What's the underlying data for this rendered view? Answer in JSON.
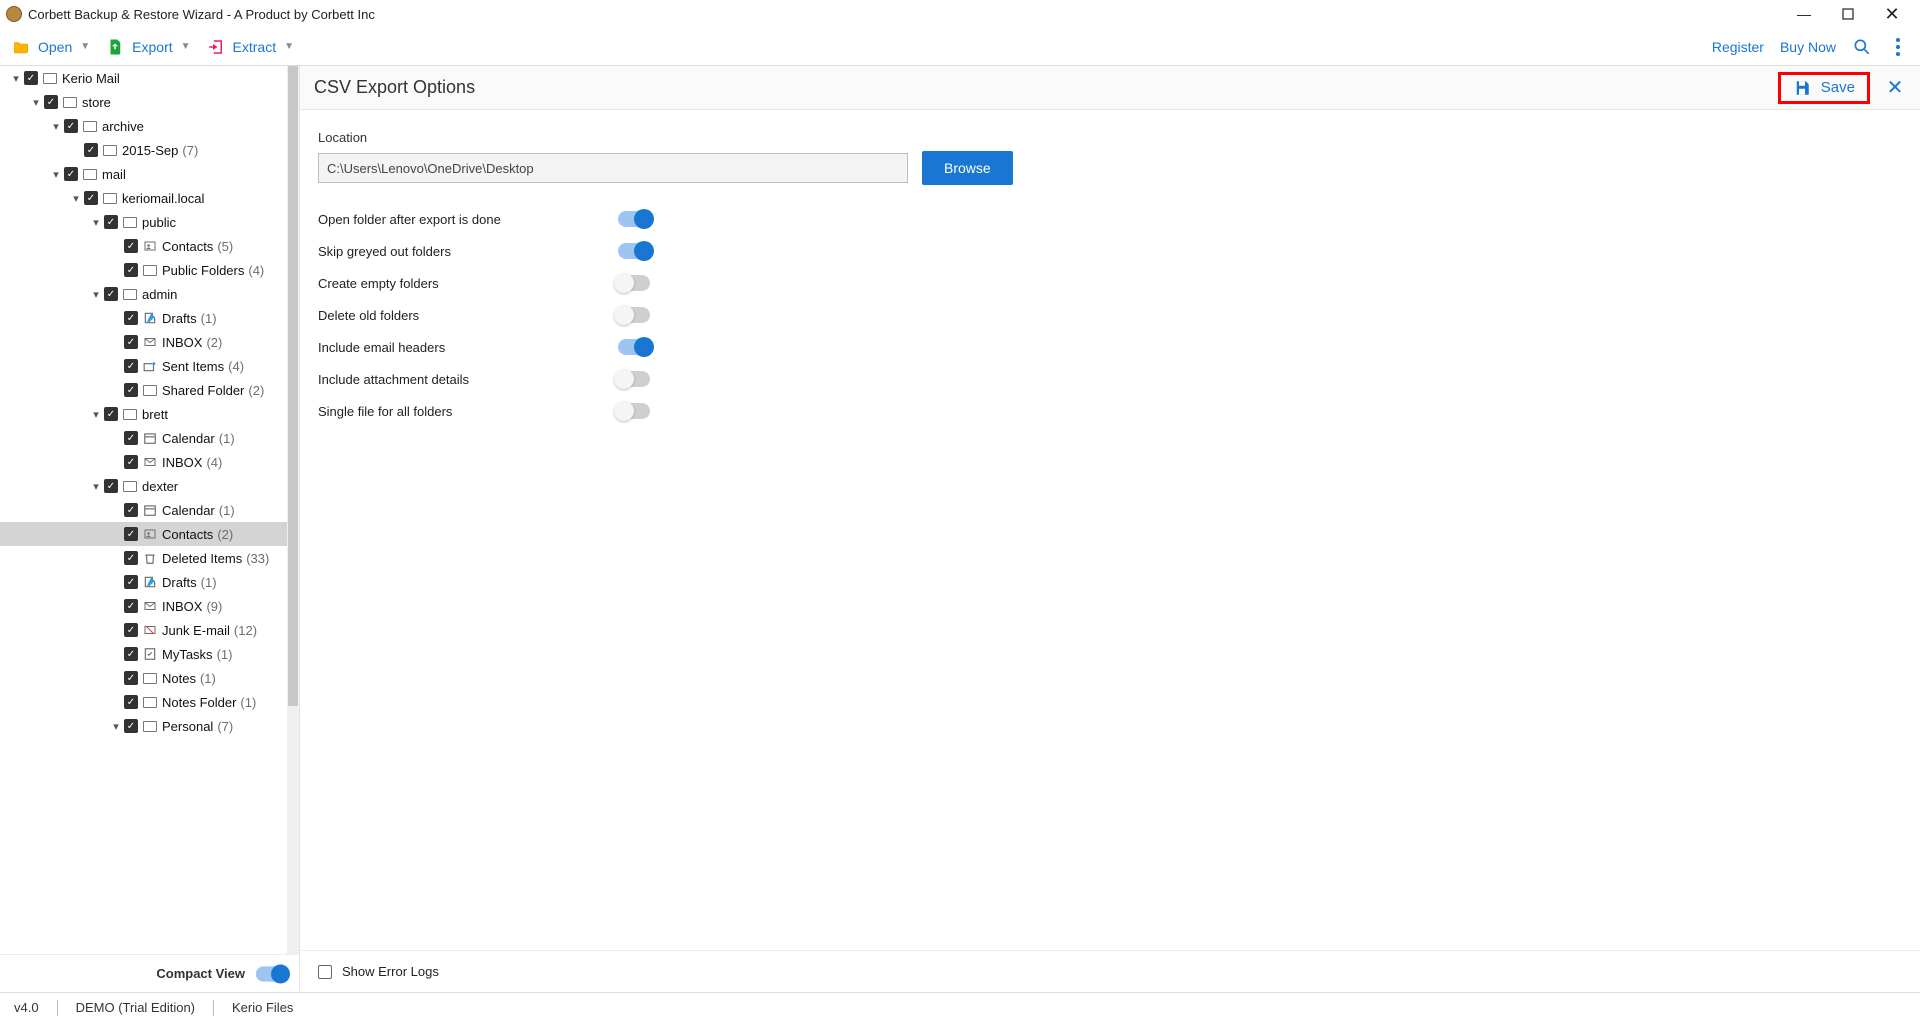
{
  "title": "Corbett Backup & Restore Wizard - A Product by Corbett Inc",
  "toolbar": {
    "open": "Open",
    "export": "Export",
    "extract": "Extract",
    "register": "Register",
    "buy": "Buy Now"
  },
  "tree": [
    {
      "indent": 0,
      "arrow": "down",
      "name": "Kerio Mail",
      "icon": "folder",
      "count": null,
      "selected": false
    },
    {
      "indent": 1,
      "arrow": "down",
      "name": "store",
      "icon": "folder",
      "count": null,
      "selected": false
    },
    {
      "indent": 2,
      "arrow": "down",
      "name": "archive",
      "icon": "folder",
      "count": null,
      "selected": false
    },
    {
      "indent": 3,
      "arrow": "none",
      "name": "2015-Sep",
      "icon": "folder",
      "count": "(7)",
      "selected": false
    },
    {
      "indent": 2,
      "arrow": "down",
      "name": "mail",
      "icon": "folder",
      "count": null,
      "selected": false
    },
    {
      "indent": 3,
      "arrow": "down",
      "name": "keriomail.local",
      "icon": "folder",
      "count": null,
      "selected": false
    },
    {
      "indent": 4,
      "arrow": "down",
      "name": "public",
      "icon": "folder",
      "count": null,
      "selected": false
    },
    {
      "indent": 5,
      "arrow": "none",
      "name": "Contacts",
      "icon": "contacts",
      "count": "(5)",
      "selected": false
    },
    {
      "indent": 5,
      "arrow": "none",
      "name": "Public Folders",
      "icon": "folder",
      "count": "(4)",
      "selected": false
    },
    {
      "indent": 4,
      "arrow": "down",
      "name": "admin",
      "icon": "folder",
      "count": null,
      "selected": false
    },
    {
      "indent": 5,
      "arrow": "none",
      "name": "Drafts",
      "icon": "drafts",
      "count": "(1)",
      "selected": false
    },
    {
      "indent": 5,
      "arrow": "none",
      "name": "INBOX",
      "icon": "inbox",
      "count": "(2)",
      "selected": false
    },
    {
      "indent": 5,
      "arrow": "none",
      "name": "Sent Items",
      "icon": "sent",
      "count": "(4)",
      "selected": false
    },
    {
      "indent": 5,
      "arrow": "none",
      "name": "Shared Folder",
      "icon": "folder",
      "count": "(2)",
      "selected": false
    },
    {
      "indent": 4,
      "arrow": "down",
      "name": "brett",
      "icon": "folder",
      "count": null,
      "selected": false
    },
    {
      "indent": 5,
      "arrow": "none",
      "name": "Calendar",
      "icon": "calendar",
      "count": "(1)",
      "selected": false
    },
    {
      "indent": 5,
      "arrow": "none",
      "name": "INBOX",
      "icon": "inbox",
      "count": "(4)",
      "selected": false
    },
    {
      "indent": 4,
      "arrow": "down",
      "name": "dexter",
      "icon": "folder",
      "count": null,
      "selected": false
    },
    {
      "indent": 5,
      "arrow": "none",
      "name": "Calendar",
      "icon": "calendar",
      "count": "(1)",
      "selected": false
    },
    {
      "indent": 5,
      "arrow": "none",
      "name": "Contacts",
      "icon": "contacts",
      "count": "(2)",
      "selected": true
    },
    {
      "indent": 5,
      "arrow": "none",
      "name": "Deleted Items",
      "icon": "trash",
      "count": "(33)",
      "selected": false
    },
    {
      "indent": 5,
      "arrow": "none",
      "name": "Drafts",
      "icon": "drafts",
      "count": "(1)",
      "selected": false
    },
    {
      "indent": 5,
      "arrow": "none",
      "name": "INBOX",
      "icon": "inbox",
      "count": "(9)",
      "selected": false
    },
    {
      "indent": 5,
      "arrow": "none",
      "name": "Junk E-mail",
      "icon": "junk",
      "count": "(12)",
      "selected": false
    },
    {
      "indent": 5,
      "arrow": "none",
      "name": "MyTasks",
      "icon": "tasks",
      "count": "(1)",
      "selected": false
    },
    {
      "indent": 5,
      "arrow": "none",
      "name": "Notes",
      "icon": "folder",
      "count": "(1)",
      "selected": false
    },
    {
      "indent": 5,
      "arrow": "none",
      "name": "Notes Folder",
      "icon": "folder",
      "count": "(1)",
      "selected": false
    },
    {
      "indent": 5,
      "arrow": "down",
      "name": "Personal",
      "icon": "folder",
      "count": "(7)",
      "selected": false
    }
  ],
  "side_footer": {
    "compact": "Compact View"
  },
  "panel": {
    "title": "CSV Export Options",
    "save": "Save",
    "location_label": "Location",
    "location_value": "C:\\Users\\Lenovo\\OneDrive\\Desktop",
    "browse": "Browse",
    "options": [
      {
        "label": "Open folder after export is done",
        "on": true
      },
      {
        "label": "Skip greyed out folders",
        "on": true
      },
      {
        "label": "Create empty folders",
        "on": false
      },
      {
        "label": "Delete old folders",
        "on": false
      },
      {
        "label": "Include email headers",
        "on": true
      },
      {
        "label": "Include attachment details",
        "on": false
      },
      {
        "label": "Single file for all folders",
        "on": false
      }
    ],
    "error_logs": "Show Error Logs"
  },
  "status": {
    "version": "v4.0",
    "edition": "DEMO (Trial Edition)",
    "source": "Kerio Files"
  }
}
